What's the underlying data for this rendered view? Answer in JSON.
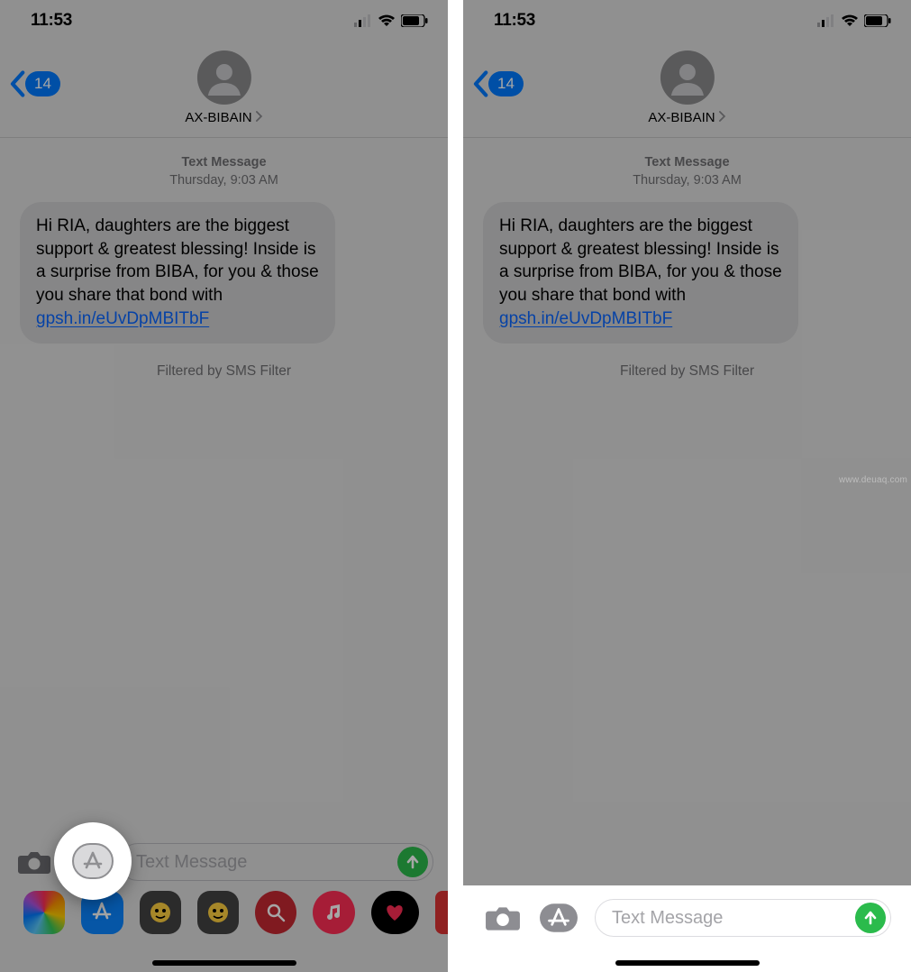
{
  "status": {
    "time": "11:53"
  },
  "header": {
    "back_count": "14",
    "contact_name": "AX-BIBAIN"
  },
  "thread": {
    "type_label": "Text Message",
    "date_label": "Thursday, 9:03 AM",
    "message_text": "Hi RIA, daughters are the biggest support & greatest blessing! Inside is a surprise from BIBA, for you & those you share that bond with ",
    "message_link": "gpsh.in/eUvDpMBITbF",
    "filtered_label": "Filtered by SMS Filter"
  },
  "composer": {
    "placeholder": "Text Message"
  },
  "colors": {
    "ios_blue": "#007aff",
    "send_green": "#2bbb4c",
    "link_blue": "#0a66ff",
    "bubble_gray": "#cececf"
  },
  "app_strip": {
    "items": [
      {
        "name": "photos-icon"
      },
      {
        "name": "app-store-icon"
      },
      {
        "name": "memoji-icon"
      },
      {
        "name": "memoji2-icon"
      },
      {
        "name": "search-app-icon"
      },
      {
        "name": "music-icon"
      },
      {
        "name": "health-icon"
      },
      {
        "name": "more-icon"
      }
    ]
  },
  "watermark": "www.deuaq.com"
}
